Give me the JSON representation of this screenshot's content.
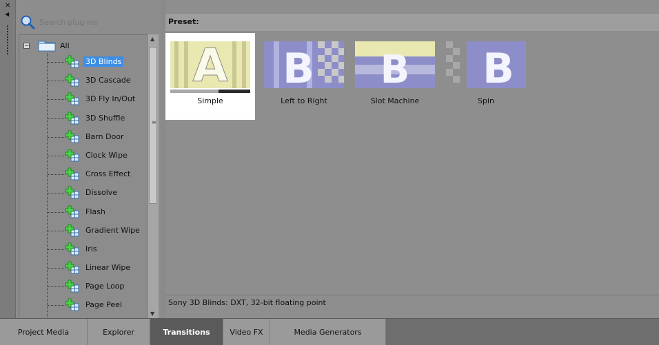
{
  "search": {
    "placeholder": "Search plug-ins"
  },
  "tree": {
    "root": {
      "label": "All",
      "expander": "−"
    },
    "items": [
      {
        "label": "3D Blinds",
        "selected": true
      },
      {
        "label": "3D Cascade"
      },
      {
        "label": "3D Fly In/Out"
      },
      {
        "label": "3D Shuffle"
      },
      {
        "label": "Barn Door"
      },
      {
        "label": "Clock Wipe"
      },
      {
        "label": "Cross Effect"
      },
      {
        "label": "Dissolve"
      },
      {
        "label": "Flash"
      },
      {
        "label": "Gradient Wipe"
      },
      {
        "label": "Iris"
      },
      {
        "label": "Linear Wipe"
      },
      {
        "label": "Page Loop"
      },
      {
        "label": "Page Peel"
      }
    ]
  },
  "preset": {
    "header": "Preset:",
    "items": [
      {
        "name": "Simple",
        "letter": "A",
        "selected": true,
        "progress": 0.6
      },
      {
        "name": "Left to Right",
        "letter": "B"
      },
      {
        "name": "Slot Machine",
        "letter": "B"
      },
      {
        "name": "Spin",
        "letter": "B"
      }
    ]
  },
  "status": "Sony 3D Blinds: DXT, 32-bit floating point",
  "tabs": [
    {
      "label": "Project Media"
    },
    {
      "label": "Explorer"
    },
    {
      "label": "Transitions",
      "active": true
    },
    {
      "label": "Video FX"
    },
    {
      "label": "Media Generators"
    }
  ],
  "icons": {
    "window_close": "close-icon",
    "dock_arrow": "triangle-left-icon",
    "search": "search-icon",
    "folder": "folder-icon",
    "plugin": "plugin-icon"
  },
  "colors": {
    "selection": "#3d8ee6",
    "panel": "#8e8e8e",
    "active_tab": "#5a5a5a"
  }
}
